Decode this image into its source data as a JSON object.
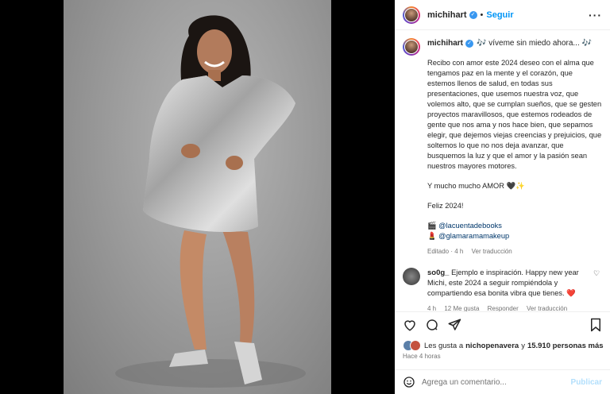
{
  "header": {
    "username": "michihart",
    "follow_label": "Seguir"
  },
  "caption": {
    "username": "michihart",
    "title": "🎶 víveme sin miedo ahora... 🎶",
    "paragraph1": "Recibo con amor este 2024 deseo con el alma que tengamos paz en la mente y el corazón, que estemos llenos de salud, en todas sus presentaciones, que usemos nuestra voz, que volemos alto, que se cumplan sueños, que se gesten proyectos maravillosos, que estemos rodeados de gente que nos ama y nos hace bien, que sepamos elegir, que dejemos viejas creencias y prejuicios, que soltemos lo que no nos deja avanzar, que busquemos la luz y que el amor y la pasión sean nuestros mayores motores.",
    "paragraph2": "Y mucho mucho AMOR 🖤✨",
    "paragraph3": "Feliz 2024!",
    "credit1_emoji": "🎬",
    "credit1": "@lacuentadebooks",
    "credit2_emoji": "💄",
    "credit2": "@glamaramamakeup",
    "edited": "Editado · 4 h",
    "translate": "Ver traducción"
  },
  "comment": {
    "username": "so0g_",
    "text": "Ejemplo e inspiración. Happy new year Michi, este 2024 a seguir rompiéndola y compartiendo esa bonita vibra que tienes. ❤️",
    "time": "4 h",
    "likes": "12 Me gusta",
    "reply": "Responder",
    "translate": "Ver traducción"
  },
  "likes": {
    "prefix": "Les gusta a",
    "user": "nichopenavera",
    "middle": "y",
    "count": "15.910 personas más"
  },
  "timestamp": "Hace 4 horas",
  "add_comment": {
    "placeholder": "Agrega un comentario...",
    "post_label": "Publicar"
  },
  "colors": {
    "accent": "#0095f6",
    "verified": "#3897f0"
  }
}
